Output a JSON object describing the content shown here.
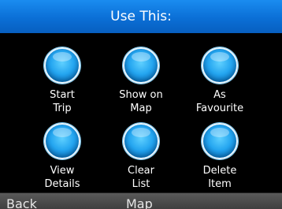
{
  "header": {
    "title": "Use This:"
  },
  "actions": [
    {
      "label": "Start\nTrip",
      "icon": "blue-orb-icon"
    },
    {
      "label": "Show on\nMap",
      "icon": "blue-orb-icon"
    },
    {
      "label": "As\nFavourite",
      "icon": "blue-orb-icon"
    },
    {
      "label": "View\nDetails",
      "icon": "blue-orb-icon"
    },
    {
      "label": "Clear\nList",
      "icon": "blue-orb-icon"
    },
    {
      "label": "Delete\nItem",
      "icon": "blue-orb-icon"
    }
  ],
  "softkeys": {
    "left": "Back",
    "center": "Map"
  },
  "colors": {
    "title_bar": "#0b6fd6",
    "orb": "#25a6f0",
    "background": "#000000",
    "softkey_bar": "#4a4a4a"
  }
}
